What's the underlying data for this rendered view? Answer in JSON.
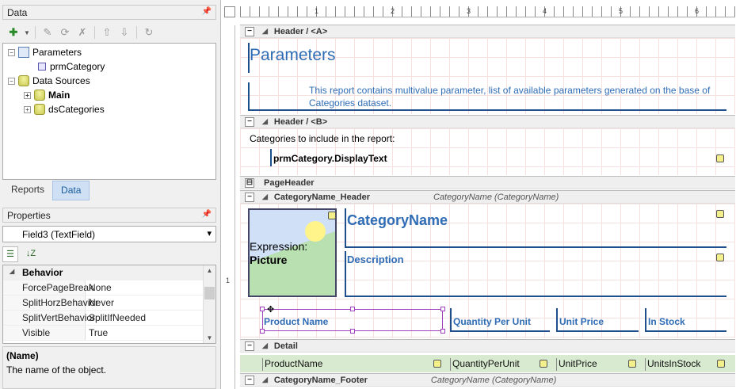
{
  "data_panel": {
    "title": "Data",
    "tree": {
      "parameters": "Parameters",
      "param_category": "prmCategory",
      "data_sources": "Data Sources",
      "main": "Main",
      "categories": "dsCategories"
    }
  },
  "tabs": {
    "reports": "Reports",
    "data": "Data"
  },
  "properties": {
    "title": "Properties",
    "selected_object": "Field3 (TextField)",
    "category": "Behavior",
    "rows": [
      {
        "name": "ForcePageBreak",
        "value": "None"
      },
      {
        "name": "SplitHorzBehavior",
        "value": "Never"
      },
      {
        "name": "SplitVertBehavior",
        "value": "SplitIfNeeded"
      },
      {
        "name": "Visible",
        "value": "True"
      }
    ],
    "desc_title": "(Name)",
    "desc_text": "The name of the object."
  },
  "ruler": {
    "marks": [
      "1",
      "2",
      "3",
      "4",
      "5",
      "6"
    ],
    "vmark": "1"
  },
  "report": {
    "header_a": "Header / <A>",
    "params_title": "Parameters",
    "params_desc_1": "This report contains multivalue parameter, list of available parameters generated on the base of",
    "params_desc_2": "Categories dataset.",
    "header_b": "Header / <B>",
    "categories_label": "Categories to include in the report:",
    "display_text": "prmCategory.DisplayText",
    "page_header": "PageHeader",
    "cat_header": "CategoryName_Header",
    "cat_header_hint": "CategoryName (CategoryName)",
    "expression_label": "Expression:",
    "expression_value": "Picture",
    "category_name": "CategoryName",
    "description": "Description",
    "col_product": "Product Name",
    "col_qty": "Quantity Per Unit",
    "col_price": "Unit Price",
    "col_stock": "In Stock",
    "detail": "Detail",
    "d_product": "ProductName",
    "d_qty": "QuantityPerUnit",
    "d_price": "UnitPrice",
    "d_stock": "UnitsInStock",
    "cat_footer": "CategoryName_Footer",
    "cat_footer_hint": "CategoryName (CategoryName)"
  }
}
